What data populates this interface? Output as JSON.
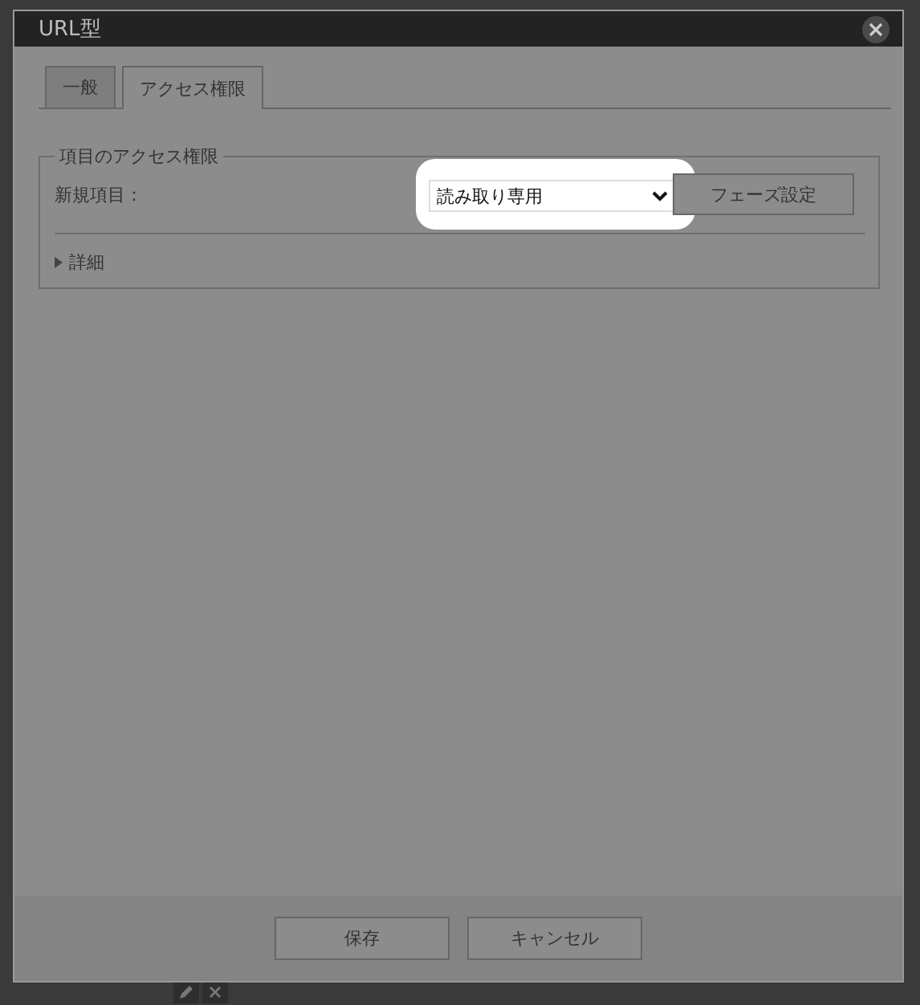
{
  "dialog": {
    "title": "URL型"
  },
  "tabs": [
    {
      "label": "一般",
      "selected": false
    },
    {
      "label": "アクセス権限",
      "selected": true
    }
  ],
  "section": {
    "legend": "項目のアクセス権限",
    "field_label": "新規項目：",
    "select": {
      "value": "読み取り専用",
      "highlighted": true
    },
    "phase_button": "フェーズ設定",
    "details": {
      "label": "詳細",
      "expanded": false
    }
  },
  "buttons": [
    "保存",
    "キャンセル"
  ]
}
